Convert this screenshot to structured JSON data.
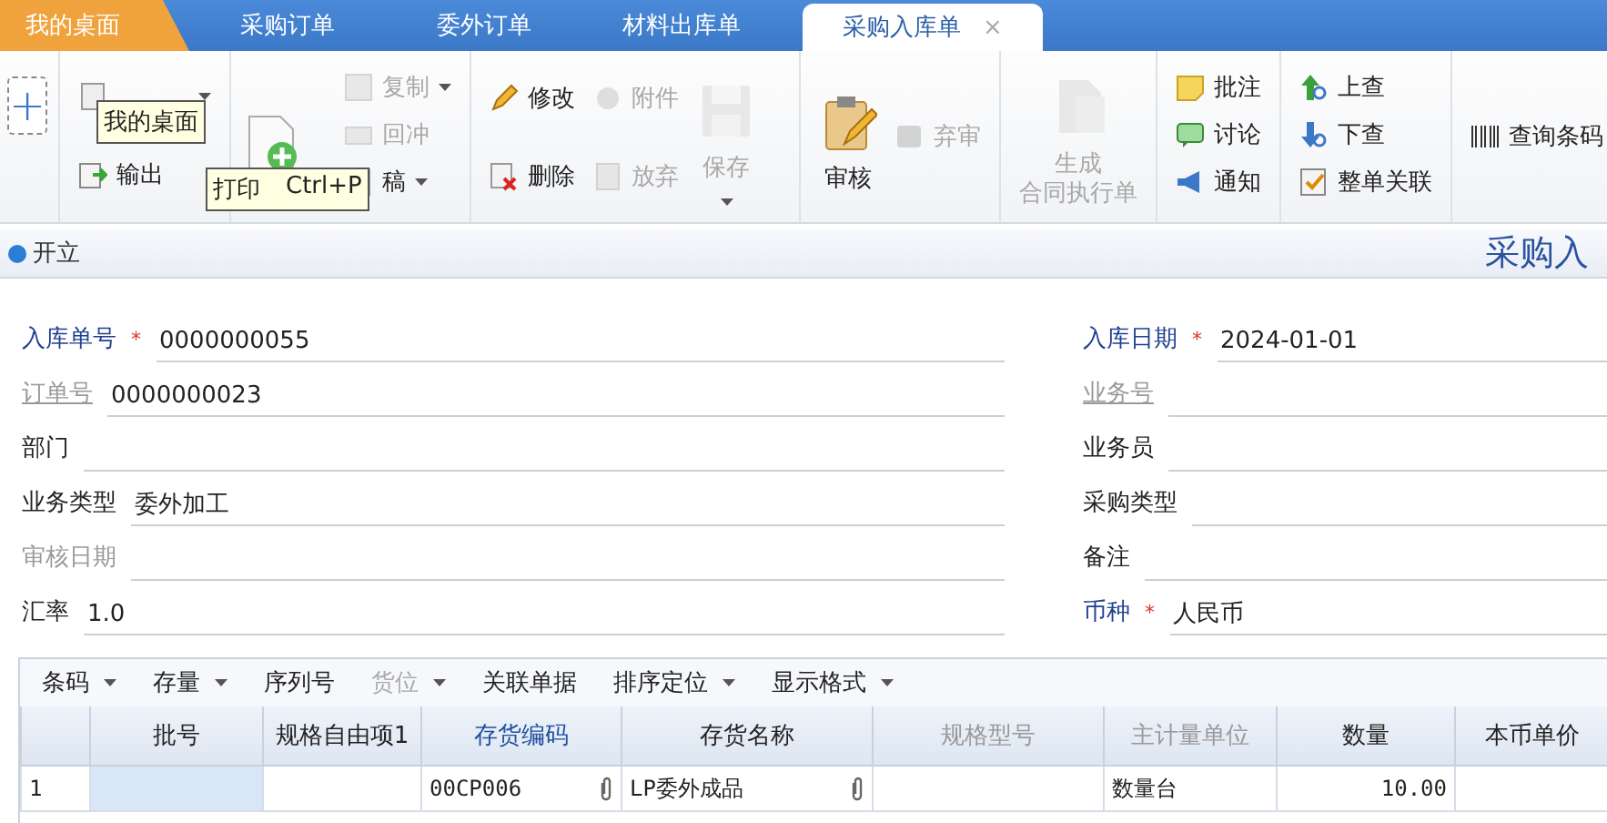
{
  "tabs": [
    {
      "label": "我的桌面",
      "kind": "home",
      "selected": false,
      "closable": false
    },
    {
      "label": "采购订单",
      "kind": "doc",
      "selected": false,
      "closable": false
    },
    {
      "label": "委外订单",
      "kind": "doc",
      "selected": false,
      "closable": false
    },
    {
      "label": "材料出库单",
      "kind": "doc",
      "selected": false,
      "closable": false
    },
    {
      "label": "采购入库单",
      "kind": "doc",
      "selected": true,
      "closable": true
    }
  ],
  "close_glyph": "×",
  "new_tab_glyph": "+",
  "toolbar": {
    "groups": [
      {
        "columns": [
          [
            {
              "kind": "small",
              "disabled": false,
              "dropdown": true
            },
            {
              "kind": "small",
              "label": [
                "输出"
              ],
              "disabled": false,
              "dropdown": false
            }
          ]
        ]
      },
      {
        "columns": [
          [
            {
              "kind": "big",
              "disabled": false,
              "dropdown": false
            }
          ],
          [
            {
              "kind": "small",
              "label": [
                "复制"
              ],
              "disabled": true,
              "dropdown": true
            },
            {
              "kind": "small",
              "label": [
                "回冲"
              ],
              "disabled": true,
              "dropdown": false
            },
            {
              "kind": "small",
              "label": [
                "稿"
              ],
              "disabled": false,
              "dropdown": true
            }
          ]
        ]
      },
      {
        "columns": [
          [
            {
              "kind": "small",
              "label": [
                "修改"
              ],
              "disabled": false,
              "dropdown": false
            },
            {
              "kind": "small",
              "label": [
                "删除"
              ],
              "disabled": false,
              "dropdown": false
            }
          ],
          [
            {
              "kind": "small",
              "label": [
                "附件"
              ],
              "disabled": true,
              "dropdown": false
            },
            {
              "kind": "small",
              "label": [
                "放弃"
              ],
              "disabled": true,
              "dropdown": false
            }
          ],
          [
            {
              "kind": "big",
              "label": [
                "保存"
              ],
              "disabled": true,
              "dropdown": true
            }
          ]
        ]
      },
      {
        "columns": [
          [
            {
              "kind": "big",
              "label": [
                "审核"
              ],
              "disabled": false,
              "dropdown": false
            }
          ],
          [
            {
              "kind": "small",
              "label": [
                "弃审"
              ],
              "disabled": true,
              "dropdown": false
            }
          ]
        ]
      },
      {
        "columns": [
          [
            {
              "kind": "big",
              "label": [
                "生成",
                "合同执行单"
              ],
              "disabled": true,
              "dropdown": false
            }
          ]
        ]
      },
      {
        "columns": [
          [
            {
              "kind": "small",
              "label": [
                "批注"
              ],
              "disabled": false,
              "dropdown": false
            },
            {
              "kind": "small",
              "label": [
                "讨论"
              ],
              "disabled": false,
              "dropdown": false
            },
            {
              "kind": "small",
              "label": [
                "通知"
              ],
              "disabled": false,
              "dropdown": false
            }
          ]
        ]
      },
      {
        "columns": [
          [
            {
              "kind": "small",
              "label": [
                "上查"
              ],
              "disabled": false,
              "dropdown": false
            },
            {
              "kind": "small",
              "label": [
                "下查"
              ],
              "disabled": false,
              "dropdown": false
            },
            {
              "kind": "small",
              "label": [
                "整单关联"
              ],
              "disabled": false,
              "dropdown": false
            }
          ]
        ]
      },
      {
        "columns": [
          [
            {
              "kind": "small",
              "label": [
                "查询条码"
              ],
              "disabled": false,
              "dropdown": false
            }
          ]
        ]
      }
    ]
  },
  "tooltips": [
    {
      "text": "我的桌面"
    },
    {
      "text": "打印",
      "shortcut": "Ctrl+P"
    }
  ],
  "status": {
    "state": "开立",
    "title": "采购入"
  },
  "form": {
    "required_mark": "*",
    "left": [
      {
        "label": "入库单号",
        "kind": "key",
        "required": true,
        "value": "0000000055"
      },
      {
        "label": "订单号",
        "kind": "link",
        "required": false,
        "value": "0000000023"
      },
      {
        "label": "部门",
        "kind": "normal",
        "required": false
      },
      {
        "label": "业务类型",
        "kind": "normal",
        "required": false,
        "value": "委外加工"
      },
      {
        "label": "审核日期",
        "kind": "disabled",
        "required": false
      },
      {
        "label": "汇率",
        "kind": "normal",
        "required": false,
        "value": "1.0"
      }
    ],
    "right": [
      {
        "label": "入库日期",
        "kind": "key",
        "required": true,
        "value": "2024-01-01"
      },
      {
        "label": "业务号",
        "kind": "link",
        "required": false
      },
      {
        "label": "业务员",
        "kind": "normal",
        "required": false
      },
      {
        "label": "采购类型",
        "kind": "normal",
        "required": false
      },
      {
        "label": "备注",
        "kind": "normal",
        "required": false
      },
      {
        "label": "币种",
        "kind": "key",
        "required": true,
        "value": "人民币"
      }
    ]
  },
  "grid": {
    "toolbar": [
      {
        "label": "条码",
        "dropdown": true,
        "disabled": false
      },
      {
        "label": "存量",
        "dropdown": true,
        "disabled": false
      },
      {
        "label": "序列号",
        "dropdown": false,
        "disabled": false
      },
      {
        "label": "货位",
        "dropdown": true,
        "disabled": true
      },
      {
        "label": "关联单据",
        "dropdown": false,
        "disabled": false
      },
      {
        "label": "排序定位",
        "dropdown": true,
        "disabled": false
      },
      {
        "label": "显示格式",
        "dropdown": true,
        "disabled": false
      }
    ],
    "columns": [
      {
        "label": "批号",
        "kind": "normal"
      },
      {
        "label": "规格自由项1",
        "kind": "normal"
      },
      {
        "label": "存货编码",
        "kind": "key"
      },
      {
        "label": "存货名称",
        "kind": "normal"
      },
      {
        "label": "规格型号",
        "kind": "disabled"
      },
      {
        "label": "主计量单位",
        "kind": "disabled"
      },
      {
        "label": "数量",
        "kind": "normal"
      },
      {
        "label": "本币单价",
        "kind": "normal"
      }
    ],
    "rows": [
      {
        "number": "1",
        "cells": [
          {
            "selected": true,
            "attachment": false
          },
          {
            "selected": false,
            "attachment": false
          },
          {
            "text": "00CP006",
            "numeric": false,
            "attachment": true,
            "selected": false
          },
          {
            "text": "LP委外成品",
            "numeric": false,
            "attachment": true,
            "selected": false
          },
          {
            "selected": false,
            "attachment": false
          },
          {
            "text": "数量台",
            "numeric": false,
            "selected": false,
            "attachment": false
          },
          {
            "text": "10.00",
            "numeric": true,
            "selected": false,
            "attachment": false
          },
          {
            "selected": false,
            "attachment": false
          }
        ]
      }
    ]
  }
}
